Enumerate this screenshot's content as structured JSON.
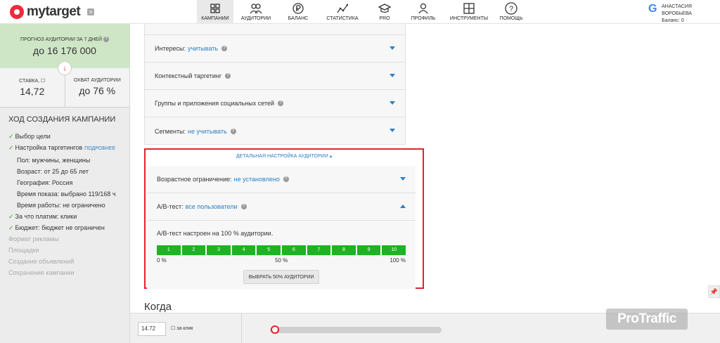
{
  "header": {
    "logo_text": "mytarget",
    "nav": [
      {
        "label": "Кампании",
        "icon": "grid-icon",
        "active": true
      },
      {
        "label": "Аудитории",
        "icon": "users-icon",
        "active": false
      },
      {
        "label": "Баланс",
        "icon": "ruble-icon",
        "active": false
      },
      {
        "label": "Статистика",
        "icon": "chart-icon",
        "active": false
      },
      {
        "label": "PRO",
        "icon": "graduation-cap-icon",
        "active": false
      },
      {
        "label": "Профиль",
        "icon": "user-icon",
        "active": false
      },
      {
        "label": "Инструменты",
        "icon": "tools-icon",
        "active": false
      },
      {
        "label": "Помощь",
        "icon": "question-icon",
        "active": false
      }
    ],
    "user": {
      "name": "АНАСТАСИЯ ВОРОБЬЕВА",
      "balance": "Баланс: 0"
    }
  },
  "sidebar": {
    "forecast_title": "Прогноз аудитории за 7 дней",
    "forecast_value": "до 16 176 000",
    "bid_title": "Ставка,",
    "bid_value": "14,72",
    "reach_title": "Охват аудитории",
    "reach_value": "до 76 %",
    "progress_title": "Ход создания кампании",
    "steps": {
      "goal": "Выбор цели",
      "targeting": "Настройка таргетингов",
      "targeting_link": "подробнее",
      "gender": "Пол: мужчины, женщины",
      "age": "Возраст: от 25 до 65 лет",
      "geo": "География: Россия",
      "show_time": "Время показа: выбрано 119/168 ч",
      "work_time": "Время работы: не ограничено",
      "pay": "За что платим: клики",
      "budget": "Бюджет: бюджет не ограничен",
      "format": "Формат рекламы",
      "sites": "Площадки",
      "ads": "Создание объявлений",
      "save": "Сохранение кампании"
    }
  },
  "targeting": {
    "interests_label": "Интересы:",
    "interests_value": "учитывать",
    "context_label": "Контекстный таргетинг",
    "groups_label": "Группы и приложения социальных сетей",
    "segments_label": "Сегменты:",
    "segments_value": "не учитывать"
  },
  "detail": {
    "toggle_label": "Детальная настройка аудитории",
    "age_label": "Возрастное ограничение:",
    "age_value": "не установлено",
    "ab_label": "A/B-тест:",
    "ab_value": "все пользователи",
    "ab_text": "A/B-тест настроен на 100 % аудитории.",
    "segments": [
      "1",
      "2",
      "3",
      "4",
      "5",
      "6",
      "7",
      "8",
      "9",
      "10"
    ],
    "scale_min": "0 %",
    "scale_mid": "50 %",
    "scale_max": "100 %",
    "button_label": "Выбрать 50% аудитории"
  },
  "when_title": "Когда",
  "bottom": {
    "bid_value": "14.72",
    "per_click": "за клик"
  },
  "watermark": "ProTraffic",
  "colors": {
    "accent": "#2a7fc4",
    "highlight": "#e0232e",
    "segment": "#1eb322",
    "forecast_bg": "#cfe6c6"
  }
}
